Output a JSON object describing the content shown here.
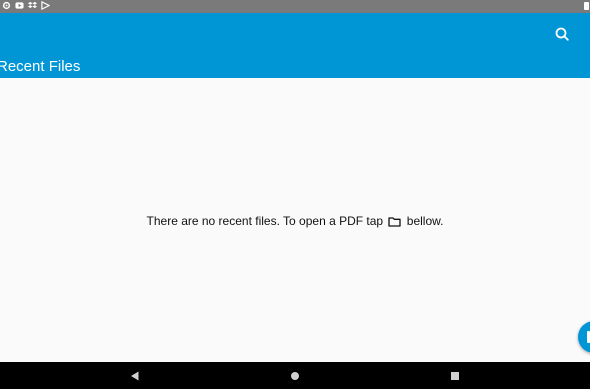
{
  "status_bar": {
    "icons": [
      "settings-icon",
      "youtube-icon",
      "dropbox-icon",
      "play-store-icon"
    ],
    "right_icon": "battery-icon"
  },
  "app_bar": {
    "title": "Recent Files",
    "search_icon": "search-icon",
    "color": "#0096d6"
  },
  "empty_state": {
    "text_before_icon": "There are no recent files. To open a PDF tap",
    "icon": "folder-icon",
    "text_after_icon": "bellow."
  },
  "fab": {
    "icon": "open-file-icon"
  },
  "nav_bar": {
    "buttons": [
      "back-icon",
      "home-icon",
      "recents-icon"
    ]
  }
}
